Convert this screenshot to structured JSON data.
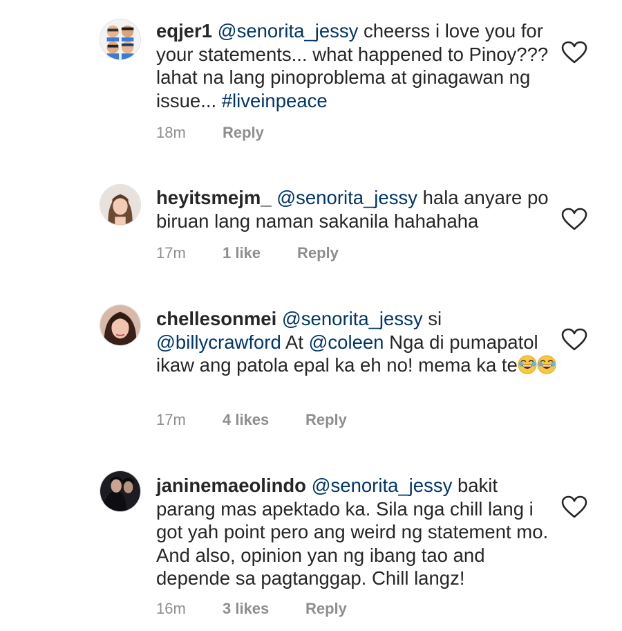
{
  "comments": [
    {
      "username": "eqjer1",
      "mention": "@senorita_jessy",
      "text_before_tag": " cheerss i love you for your statements... what happened to Pinoy??? lahat na lang pinoproblema at ginagawan ng issue... ",
      "hashtag": "#liveinpeace",
      "time": "18m",
      "likes": "",
      "reply_label": "Reply"
    },
    {
      "username": "heyitsmejm_",
      "mention": "@senorita_jessy",
      "text": " hala anyare po biruan lang naman sakanila hahahaha",
      "time": "17m",
      "likes": "1 like",
      "reply_label": "Reply"
    },
    {
      "username": "chellesonmei",
      "mention": "@senorita_jessy",
      "text_si": " si ",
      "mention2": "@billycrawford",
      "text_at": " At ",
      "mention3": "@coleen",
      "text": " Nga di pumapatol ikaw ang patola epal ka eh no! mema ka te",
      "emoji": "face-with-tears-of-joy-icon",
      "time": "17m",
      "likes": "4 likes",
      "reply_label": "Reply"
    },
    {
      "username": "janinemaeolindo",
      "mention": "@senorita_jessy",
      "text": " bakit parang mas apektado ka. Sila nga chill lang i got yah point pero ang weird ng statement mo. And also, opinion yan ng ibang tao and depende sa pagtanggap. Chill langz!",
      "time": "16m",
      "likes": "3 likes",
      "reply_label": "Reply"
    }
  ],
  "colors": {
    "text": "#262626",
    "link": "#003569",
    "meta": "#8e8e8e"
  }
}
